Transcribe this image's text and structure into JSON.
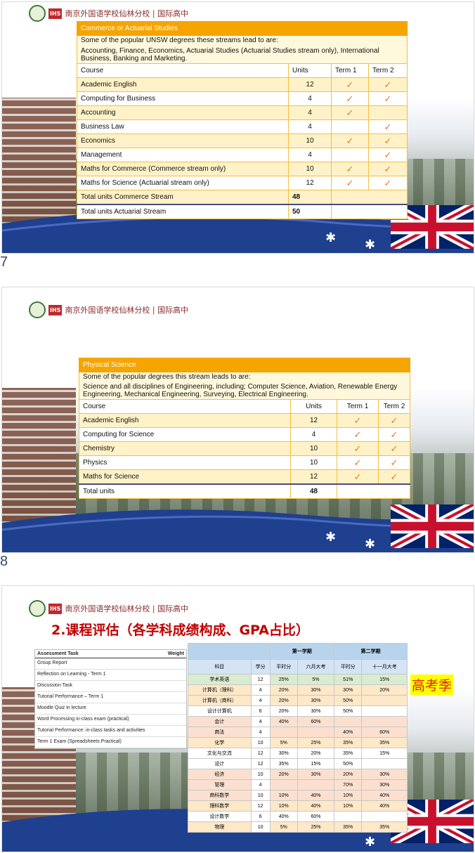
{
  "school": {
    "ihs": "IHS",
    "name": "南京外国语学校仙林分校 | 国际高中"
  },
  "slide1": {
    "page_number": "7",
    "header": "Commerce  or Actuarial Studies",
    "intro_line1": "Some of the popular UNSW degrees these streams lead to are:",
    "intro_line2": "Accounting, Finance, Economics, Actuarial Studies (Actuarial Studies stream only), International Business, Banking and Marketing.",
    "columns": [
      "Course",
      "Units",
      "Term 1",
      "Term 2"
    ],
    "rows": [
      {
        "course": "Academic English",
        "units": "12",
        "t1": "✓",
        "t2": "✓"
      },
      {
        "course": "Computing for Business",
        "units": "4",
        "t1": "✓",
        "t2": "✓"
      },
      {
        "course": "Accounting",
        "units": "4",
        "t1": "✓",
        "t2": ""
      },
      {
        "course": "Business Law",
        "units": "4",
        "t1": "",
        "t2": "✓"
      },
      {
        "course": "Economics",
        "units": "10",
        "t1": "✓",
        "t2": "✓"
      },
      {
        "course": "Management",
        "units": "4",
        "t1": "",
        "t2": "✓"
      },
      {
        "course": "Maths for Commerce (Commerce stream only)",
        "units": "10",
        "t1": "✓",
        "t2": "✓"
      },
      {
        "course": "Maths for Science (Actuarial stream only)",
        "units": "12",
        "t1": "✓",
        "t2": "✓"
      }
    ],
    "total1_label": "Total units Commerce Stream",
    "total1_value": "48",
    "total2_label": "Total units Actuarial Stream",
    "total2_value": "50"
  },
  "slide2": {
    "page_number": "8",
    "header": "Physical Science",
    "intro_line1": "Some of the popular degrees this stream leads to are:",
    "intro_line2": "Science and all disciplines of Engineering, including; Computer Science, Aviation, Renewable Energy Engineering, Mechanical Engineering, Surveying, Electrical Engineering.",
    "columns": [
      "Course",
      "Units",
      "Term 1",
      "Term 2"
    ],
    "rows": [
      {
        "course": "Academic English",
        "units": "12",
        "t1": "✓",
        "t2": "✓"
      },
      {
        "course": "Computing for Science",
        "units": "4",
        "t1": "✓",
        "t2": "✓"
      },
      {
        "course": "Chemistry",
        "units": "10",
        "t1": "✓",
        "t2": "✓"
      },
      {
        "course": "Physics",
        "units": "10",
        "t1": "✓",
        "t2": "✓"
      },
      {
        "course": "Maths for Science",
        "units": "12",
        "t1": "✓",
        "t2": "✓"
      }
    ],
    "total_label": "Total units",
    "total_value": "48"
  },
  "slide3": {
    "title": "2.课程评估（各学科成绩构成、GPA占比）",
    "assessment": {
      "col_task": "Assessment Task",
      "col_weight": "Weight",
      "rows": [
        "Group Report",
        "Reflection on Learning - Term 1",
        "Discussion Task",
        "Tutorial Performance – Term 1",
        "Moodle Quiz in lecture",
        "Word Processing in-class exam (practical)",
        "Tutorial Performance: in-class tasks and activities",
        "Term 1 Exam (Spreadsheets Practical)"
      ]
    },
    "grades": {
      "sem1": "第一学期",
      "sem2": "第二学期",
      "cols": [
        "科目",
        "学分",
        "平时分",
        "六月大考",
        "平时分",
        "十一月大考"
      ],
      "rows": [
        {
          "s": "学术英语",
          "c": "12",
          "a": "25%",
          "b": "5%",
          "d": "51%",
          "e": "15%",
          "bg": "#d8ecd0"
        },
        {
          "s": "计算机（理科）",
          "c": "4",
          "a": "20%",
          "b": "30%",
          "d": "30%",
          "e": "20%",
          "bg": "#fde8c8"
        },
        {
          "s": "计算机（商科）",
          "c": "4",
          "a": "20%",
          "b": "30%",
          "d": "50%",
          "e": "",
          "bg": "#fde8c8"
        },
        {
          "s": "设计计算机",
          "c": "6",
          "a": "20%",
          "b": "30%",
          "d": "50%",
          "e": "",
          "bg": "#ffffff"
        },
        {
          "s": "会计",
          "c": "4",
          "a": "40%",
          "b": "60%",
          "d": "",
          "e": "",
          "bg": "#fbe0d0"
        },
        {
          "s": "商法",
          "c": "4",
          "a": "",
          "b": "",
          "d": "40%",
          "e": "60%",
          "bg": "#fbe0d0"
        },
        {
          "s": "化学",
          "c": "10",
          "a": "5%",
          "b": "25%",
          "d": "35%",
          "e": "35%",
          "bg": "#fde8c8"
        },
        {
          "s": "文化与交流",
          "c": "12",
          "a": "30%",
          "b": "20%",
          "d": "35%",
          "e": "15%",
          "bg": "#ffffff"
        },
        {
          "s": "设计",
          "c": "12",
          "a": "35%",
          "b": "15%",
          "d": "50%",
          "e": "",
          "bg": "#ffffff"
        },
        {
          "s": "经济",
          "c": "10",
          "a": "20%",
          "b": "30%",
          "d": "20%",
          "e": "30%",
          "bg": "#fbe0d0"
        },
        {
          "s": "管理",
          "c": "4",
          "a": "",
          "b": "",
          "d": "70%",
          "e": "30%",
          "bg": "#fbe0d0"
        },
        {
          "s": "商科数学",
          "c": "10",
          "a": "10%",
          "b": "40%",
          "d": "10%",
          "e": "40%",
          "bg": "#fbe0d0"
        },
        {
          "s": "理科数学",
          "c": "12",
          "a": "10%",
          "b": "40%",
          "d": "10%",
          "e": "40%",
          "bg": "#fde8c8"
        },
        {
          "s": "设计数学",
          "c": "6",
          "a": "40%",
          "b": "60%",
          "d": "",
          "e": "",
          "bg": "#ffffff"
        },
        {
          "s": "物理",
          "c": "10",
          "a": "5%",
          "b": "25%",
          "d": "35%",
          "e": "35%",
          "bg": "#fde8c8"
        }
      ]
    },
    "badge": "高考季"
  },
  "colors": {
    "orange": "#f5a400",
    "navy": "#1f3f8f",
    "red": "#c00000",
    "tick": "#e07a2a"
  },
  "icons": [
    "school-emblem-icon",
    "ihs-logo-icon",
    "uk-flag-icon",
    "star-icon",
    "check-icon"
  ]
}
